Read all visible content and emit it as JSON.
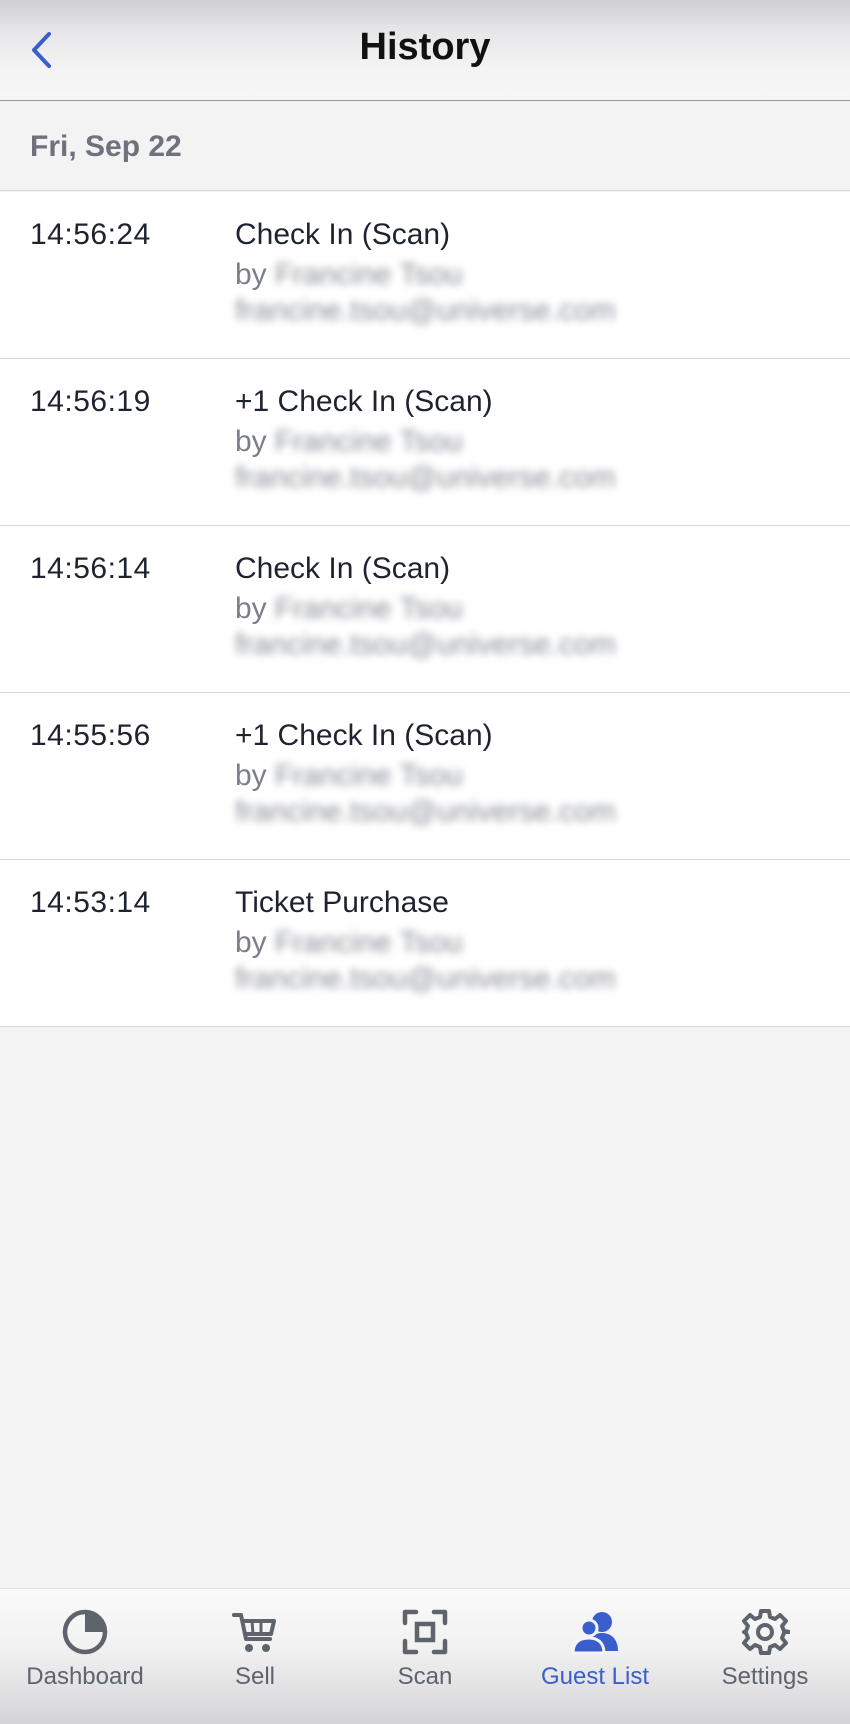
{
  "header": {
    "title": "History",
    "back_icon": "chevron-left-icon"
  },
  "section": {
    "date": "Fri, Sep 22"
  },
  "history": [
    {
      "time": "14:56:24",
      "action": "Check In (Scan)",
      "by_label": "by",
      "by_name": "Francine Tsou",
      "email": "francine.tsou@universe.com"
    },
    {
      "time": "14:56:19",
      "action": "+1 Check In (Scan)",
      "by_label": "by",
      "by_name": "Francine Tsou",
      "email": "francine.tsou@universe.com"
    },
    {
      "time": "14:56:14",
      "action": "Check In (Scan)",
      "by_label": "by",
      "by_name": "Francine Tsou",
      "email": "francine.tsou@universe.com"
    },
    {
      "time": "14:55:56",
      "action": "+1 Check In (Scan)",
      "by_label": "by",
      "by_name": "Francine Tsou",
      "email": "francine.tsou@universe.com"
    },
    {
      "time": "14:53:14",
      "action": "Ticket Purchase",
      "by_label": "by",
      "by_name": "Francine Tsou",
      "email": "francine.tsou@universe.com"
    }
  ],
  "tabbar": {
    "tabs": [
      {
        "label": "Dashboard",
        "icon": "pie-chart-icon",
        "active": false
      },
      {
        "label": "Sell",
        "icon": "cart-icon",
        "active": false
      },
      {
        "label": "Scan",
        "icon": "scan-icon",
        "active": false
      },
      {
        "label": "Guest List",
        "icon": "guests-icon",
        "active": true
      },
      {
        "label": "Settings",
        "icon": "gear-icon",
        "active": false
      }
    ]
  },
  "colors": {
    "accent": "#3a5fcd",
    "inactive_tab": "#5f636c",
    "background": "#f3f3f4"
  }
}
